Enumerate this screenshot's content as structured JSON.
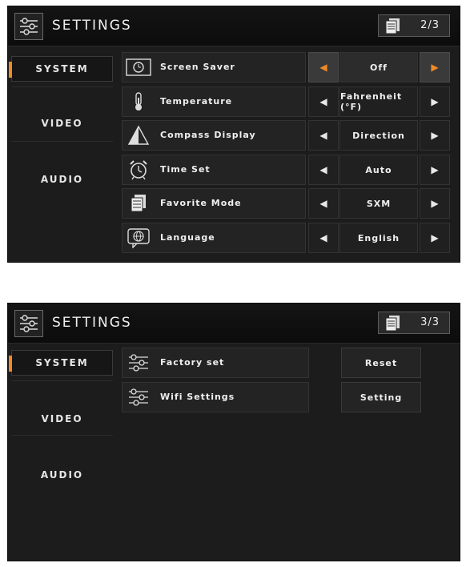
{
  "screens": [
    {
      "title": "SETTINGS",
      "page": "2/3",
      "sidebar": [
        "SYSTEM",
        "VIDEO",
        "AUDIO"
      ],
      "rows": [
        {
          "label": "Screen Saver",
          "value": "Off",
          "icon": "screen-saver-icon"
        },
        {
          "label": "Temperature",
          "value": "Fahrenheit (°F)",
          "icon": "thermometer-icon"
        },
        {
          "label": "Compass Display",
          "value": "Direction",
          "icon": "compass-icon"
        },
        {
          "label": "Time Set",
          "value": "Auto",
          "icon": "alarm-clock-icon"
        },
        {
          "label": "Favorite Mode",
          "value": "SXM",
          "icon": "favorite-mode-icon"
        },
        {
          "label": "Language",
          "value": "English",
          "icon": "globe-icon"
        }
      ]
    },
    {
      "title": "SETTINGS",
      "page": "3/3",
      "sidebar": [
        "SYSTEM",
        "VIDEO",
        "AUDIO"
      ],
      "rows": [
        {
          "label": "Factory set",
          "button": "Reset",
          "icon": "gear-settings-icon"
        },
        {
          "label": "Wifi Settings",
          "button": "Setting",
          "icon": "gear-settings-icon"
        }
      ]
    }
  ],
  "colors": {
    "accent": "#f08a24",
    "panel": "#1c1c1c",
    "row": "#232323"
  }
}
